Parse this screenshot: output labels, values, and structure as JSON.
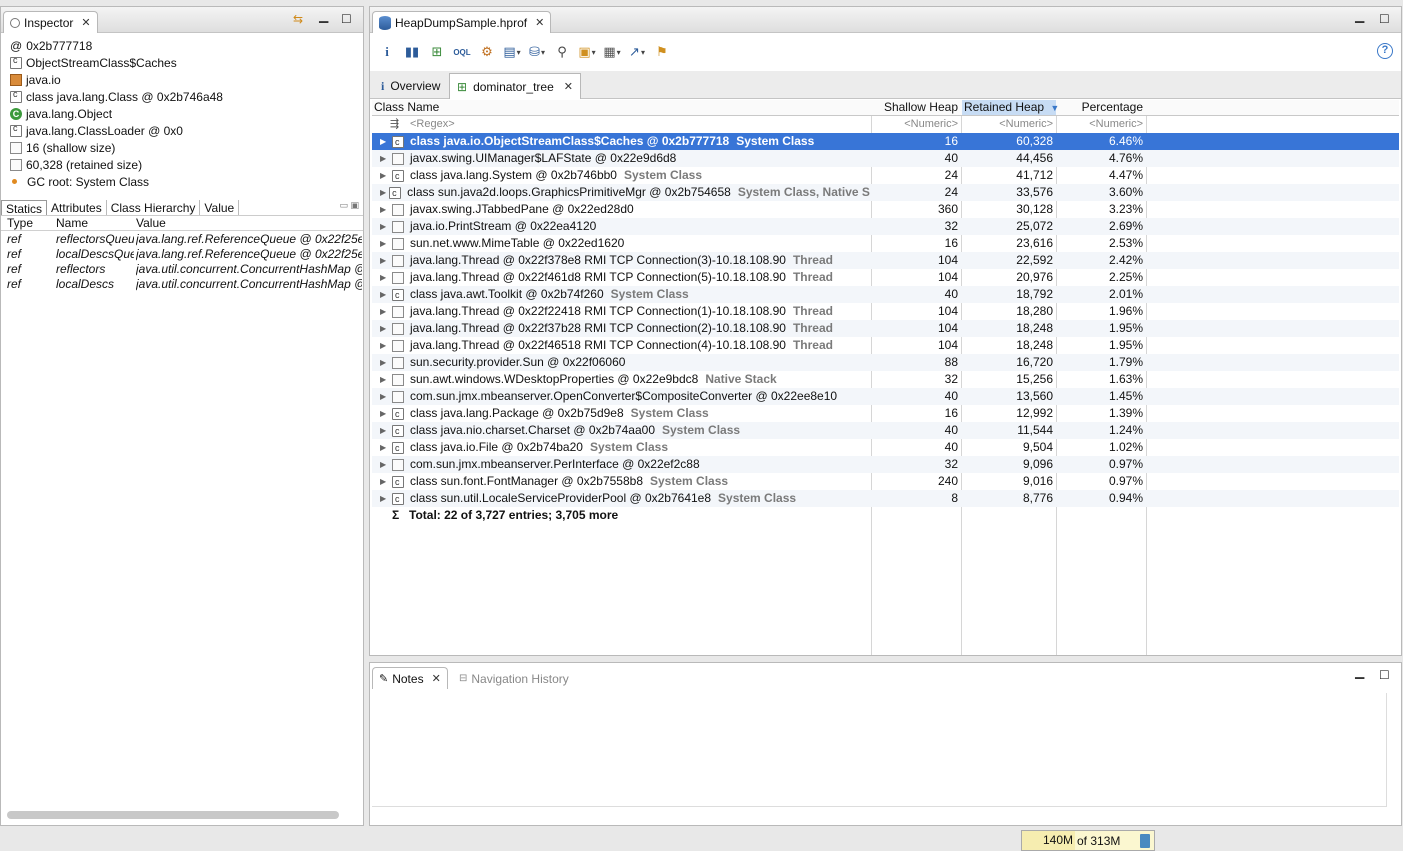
{
  "inspector": {
    "tab_label": "Inspector",
    "items": [
      {
        "icon": "at-icon",
        "text": "0x2b777718"
      },
      {
        "icon": "class-icon",
        "text": "ObjectStreamClass$Caches"
      },
      {
        "icon": "package-icon",
        "text": "java.io"
      },
      {
        "icon": "class-icon",
        "text": "class java.lang.Class @ 0x2b746a48"
      },
      {
        "icon": "object-class-icon",
        "text": "java.lang.Object"
      },
      {
        "icon": "class-icon",
        "text": "java.lang.ClassLoader @ 0x0"
      },
      {
        "icon": "size-icon",
        "text": "16 (shallow size)"
      },
      {
        "icon": "size-icon",
        "text": "60,328 (retained size)"
      },
      {
        "icon": "gc-root-icon",
        "text": "GC root: System Class"
      }
    ],
    "subtabs": [
      "Statics",
      "Attributes",
      "Class Hierarchy",
      "Value"
    ],
    "statics_columns": [
      "Type",
      "Name",
      "Value"
    ],
    "statics_rows": [
      [
        "ref",
        "reflectorsQueue",
        "java.lang.ref.ReferenceQueue @ 0x22f25e"
      ],
      [
        "ref",
        "localDescsQueue",
        "java.lang.ref.ReferenceQueue @ 0x22f25e"
      ],
      [
        "ref",
        "reflectors",
        "java.util.concurrent.ConcurrentHashMap @"
      ],
      [
        "ref",
        "localDescs",
        "java.util.concurrent.ConcurrentHashMap @"
      ]
    ]
  },
  "editor": {
    "tab_label": "HeapDumpSample.hprof",
    "help_label": "?",
    "inner_tabs": [
      "Overview",
      "dominator_tree"
    ],
    "columns": [
      "Class Name",
      "Shallow Heap",
      "Retained Heap",
      "Percentage"
    ],
    "filters": [
      "<Regex>",
      "<Numeric>",
      "<Numeric>",
      "<Numeric>"
    ],
    "rows": [
      {
        "name": "class java.io.ObjectStreamClass$Caches @ 0x2b777718",
        "suffix": "System Class",
        "shallow": "16",
        "retained": "60,328",
        "pct": "6.46%",
        "icon": "class",
        "selected": true
      },
      {
        "name": "javax.swing.UIManager$LAFState @ 0x22e9d6d8",
        "suffix": "",
        "shallow": "40",
        "retained": "44,456",
        "pct": "4.76%",
        "icon": "object"
      },
      {
        "name": "class java.lang.System @ 0x2b746bb0",
        "suffix": "System Class",
        "shallow": "24",
        "retained": "41,712",
        "pct": "4.47%",
        "icon": "class"
      },
      {
        "name": "class sun.java2d.loops.GraphicsPrimitiveMgr @ 0x2b754658",
        "suffix": "System Class, Native Sta",
        "shallow": "24",
        "retained": "33,576",
        "pct": "3.60%",
        "icon": "class"
      },
      {
        "name": "javax.swing.JTabbedPane @ 0x22ed28d0",
        "suffix": "",
        "shallow": "360",
        "retained": "30,128",
        "pct": "3.23%",
        "icon": "object"
      },
      {
        "name": "java.io.PrintStream @ 0x22ea4120",
        "suffix": "",
        "shallow": "32",
        "retained": "25,072",
        "pct": "2.69%",
        "icon": "object"
      },
      {
        "name": "sun.net.www.MimeTable @ 0x22ed1620",
        "suffix": "",
        "shallow": "16",
        "retained": "23,616",
        "pct": "2.53%",
        "icon": "object"
      },
      {
        "name": "java.lang.Thread @ 0x22f378e8  RMI TCP Connection(3)-10.18.108.90",
        "suffix": "Thread",
        "shallow": "104",
        "retained": "22,592",
        "pct": "2.42%",
        "icon": "object"
      },
      {
        "name": "java.lang.Thread @ 0x22f461d8  RMI TCP Connection(5)-10.18.108.90",
        "suffix": "Thread",
        "shallow": "104",
        "retained": "20,976",
        "pct": "2.25%",
        "icon": "object"
      },
      {
        "name": "class java.awt.Toolkit @ 0x2b74f260",
        "suffix": "System Class",
        "shallow": "40",
        "retained": "18,792",
        "pct": "2.01%",
        "icon": "class"
      },
      {
        "name": "java.lang.Thread @ 0x22f22418  RMI TCP Connection(1)-10.18.108.90",
        "suffix": "Thread",
        "shallow": "104",
        "retained": "18,280",
        "pct": "1.96%",
        "icon": "object"
      },
      {
        "name": "java.lang.Thread @ 0x22f37b28  RMI TCP Connection(2)-10.18.108.90",
        "suffix": "Thread",
        "shallow": "104",
        "retained": "18,248",
        "pct": "1.95%",
        "icon": "object"
      },
      {
        "name": "java.lang.Thread @ 0x22f46518  RMI TCP Connection(4)-10.18.108.90",
        "suffix": "Thread",
        "shallow": "104",
        "retained": "18,248",
        "pct": "1.95%",
        "icon": "object"
      },
      {
        "name": "sun.security.provider.Sun @ 0x22f06060",
        "suffix": "",
        "shallow": "88",
        "retained": "16,720",
        "pct": "1.79%",
        "icon": "object"
      },
      {
        "name": "sun.awt.windows.WDesktopProperties @ 0x22e9bdc8",
        "suffix": "Native Stack",
        "shallow": "32",
        "retained": "15,256",
        "pct": "1.63%",
        "icon": "object"
      },
      {
        "name": "com.sun.jmx.mbeanserver.OpenConverter$CompositeConverter @ 0x22ee8e10",
        "suffix": "",
        "shallow": "40",
        "retained": "13,560",
        "pct": "1.45%",
        "icon": "object"
      },
      {
        "name": "class java.lang.Package @ 0x2b75d9e8",
        "suffix": "System Class",
        "shallow": "16",
        "retained": "12,992",
        "pct": "1.39%",
        "icon": "class"
      },
      {
        "name": "class java.nio.charset.Charset @ 0x2b74aa00",
        "suffix": "System Class",
        "shallow": "40",
        "retained": "11,544",
        "pct": "1.24%",
        "icon": "class"
      },
      {
        "name": "class java.io.File @ 0x2b74ba20",
        "suffix": "System Class",
        "shallow": "40",
        "retained": "9,504",
        "pct": "1.02%",
        "icon": "class"
      },
      {
        "name": "com.sun.jmx.mbeanserver.PerInterface @ 0x22ef2c88",
        "suffix": "",
        "shallow": "32",
        "retained": "9,096",
        "pct": "0.97%",
        "icon": "object"
      },
      {
        "name": "class sun.font.FontManager @ 0x2b7558b8",
        "suffix": "System Class",
        "shallow": "240",
        "retained": "9,016",
        "pct": "0.97%",
        "icon": "class"
      },
      {
        "name": "class sun.util.LocaleServiceProviderPool @ 0x2b7641e8",
        "suffix": "System Class",
        "shallow": "8",
        "retained": "8,776",
        "pct": "0.94%",
        "icon": "class"
      }
    ],
    "total": "Total: 22 of 3,727 entries; 3,705 more"
  },
  "notes": {
    "tabs": [
      "Notes",
      "Navigation History"
    ]
  },
  "status": {
    "used": "140M",
    "of_total": "of 313M",
    "used_fraction": 0.447
  }
}
